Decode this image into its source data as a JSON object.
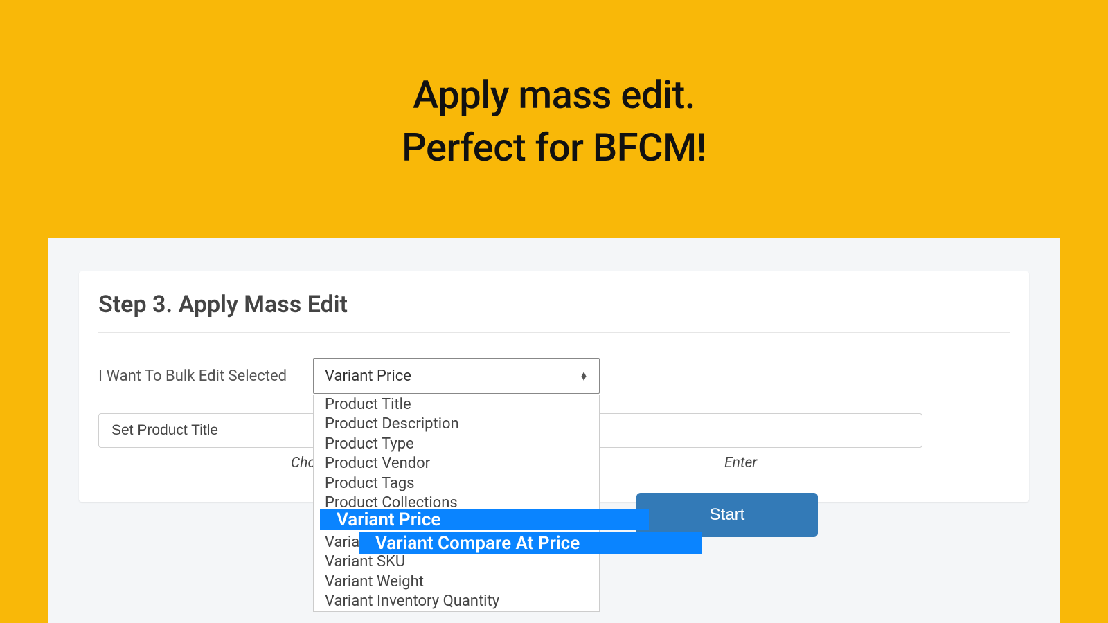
{
  "headline": {
    "line1": "Apply mass edit.",
    "line2": "Perfect for BFCM!"
  },
  "card": {
    "title": "Step 3. Apply Mass Edit",
    "bulk_edit_label": "I Want To Bulk Edit Selected",
    "select_value": "Variant Price",
    "text_input_value": "Set Product Title",
    "hint_choose": "Choo",
    "hint_enter": "Enter",
    "start_label": "Start"
  },
  "dropdown": {
    "items": [
      "Product Title",
      "Product Description",
      "Product Type",
      "Product Vendor",
      "Product Tags",
      "Product Collections",
      "Variant Price",
      "Variant Compare At Price",
      "Variant SKU",
      "Variant Weight",
      "Variant Inventory Quantity"
    ]
  },
  "highlights": {
    "h1": "Variant Price",
    "h2": "Variant Compare At Price"
  }
}
